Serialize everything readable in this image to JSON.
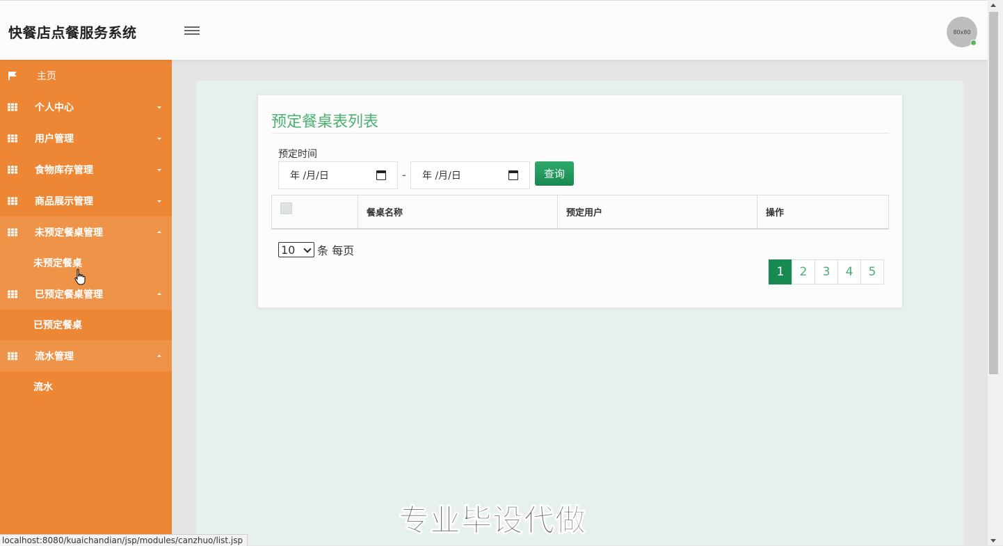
{
  "header": {
    "brand": "快餐店点餐服务系统",
    "avatar_text": "80x80"
  },
  "sidebar": {
    "home": "主页",
    "menus": [
      {
        "label": "个人中心",
        "expanded": false
      },
      {
        "label": "用户管理",
        "expanded": false
      },
      {
        "label": "食物库存管理",
        "expanded": false
      },
      {
        "label": "商品展示管理",
        "expanded": false
      },
      {
        "label": "未预定餐桌管理",
        "expanded": true,
        "sub": "未预定餐桌"
      },
      {
        "label": "已预定餐桌管理",
        "expanded": true,
        "sub": "已预定餐桌"
      },
      {
        "label": "流水管理",
        "expanded": true,
        "sub": "流水"
      }
    ]
  },
  "card": {
    "title": "预定餐桌表列表",
    "filter_label": "预定时间",
    "date_placeholder_start": "年 /月/日",
    "date_placeholder_end": "年 /月/日",
    "range_separator": "-",
    "query_button": "查询",
    "columns": [
      "",
      "餐桌名称",
      "预定用户",
      "操作"
    ],
    "page_size_value": "10",
    "page_size_suffix": "条 每页",
    "pages": [
      "1",
      "2",
      "3",
      "4",
      "5"
    ],
    "active_page": "1"
  },
  "watermark": "专业毕设代做",
  "status_url": "localhost:8080/kuaichandian/jsp/modules/canzhuo/list.jsp",
  "colors": {
    "sidebar": "#ed8735",
    "accent_green": "#4caf72",
    "button_green": "#178a52"
  }
}
